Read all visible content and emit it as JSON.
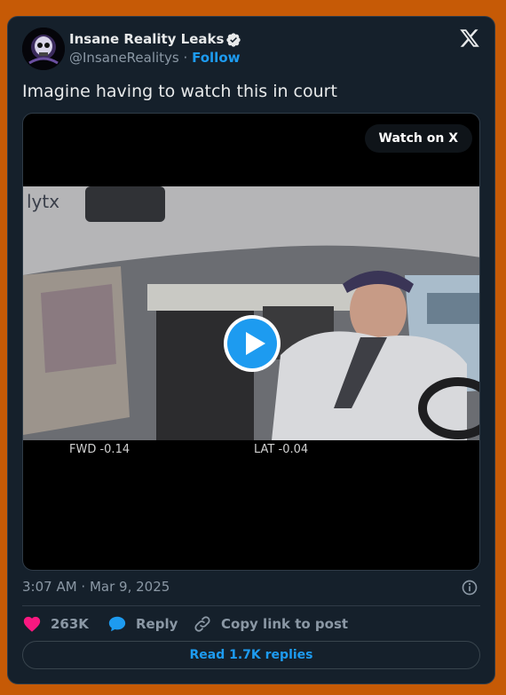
{
  "author": {
    "name": "Insane Reality Leaks",
    "handle": "@InsaneRealitys",
    "separator": "·",
    "follow_label": "Follow",
    "verified": true
  },
  "tweet": {
    "text": "Imagine having to watch this in court"
  },
  "media": {
    "watch_label": "Watch on X",
    "overlay": {
      "brand": "lytx",
      "fwd": "FWD -0.14",
      "lat": "LAT -0.04"
    }
  },
  "meta": {
    "timestamp": "3:07 AM · Mar 9, 2025"
  },
  "actions": {
    "likes": "263K",
    "reply_label": "Reply",
    "copy_label": "Copy link to post"
  },
  "read_replies_label": "Read 1.7K replies",
  "colors": {
    "background": "#c65a06",
    "card": "#15202b",
    "accent": "#1d9bf0",
    "like": "#f91880"
  },
  "icons": [
    "verified-badge-icon",
    "x-logo-icon",
    "play-icon",
    "info-icon",
    "heart-icon",
    "reply-bubble-icon",
    "link-icon"
  ]
}
